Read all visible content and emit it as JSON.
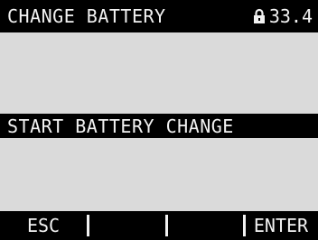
{
  "header": {
    "title": "CHANGE BATTERY",
    "lock_icon": "lock-icon",
    "status_value": "33.4"
  },
  "menu": {
    "selected_item": "START BATTERY CHANGE"
  },
  "softkeys": {
    "key1": "ESC",
    "key2": "",
    "key3": "",
    "key4": "ENTER"
  },
  "colors": {
    "bar_background": "#000000",
    "bar_text": "#f2f2f2",
    "screen_background": "#dadada"
  }
}
